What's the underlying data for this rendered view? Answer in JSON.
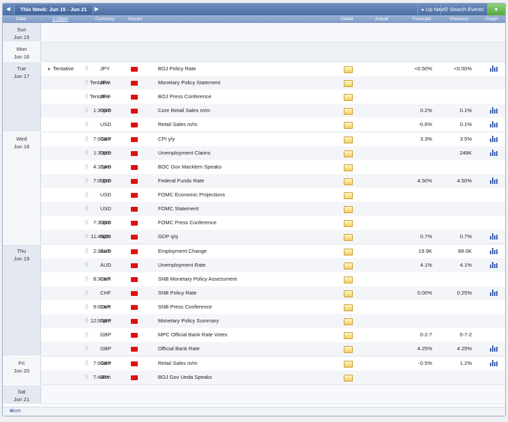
{
  "toolbar": {
    "prev_icon": "triangle-left",
    "week_label": "This Week: Jun 15 - Jun 21",
    "next_icon": "triangle-right",
    "up_next": "Up Next",
    "up_next_icon": "triangle-right",
    "search_events": "Search Events",
    "search_icon": "magnifier",
    "filter_icon": "funnel"
  },
  "headers": {
    "date": "Date",
    "time": "1:25pm",
    "currency": "Currency",
    "impact": "Impact",
    "detail": "Detail",
    "actual": "Actual",
    "forecast": "Forecast",
    "previous": "Previous",
    "graph": "Graph"
  },
  "days": [
    {
      "dow": "Sun",
      "date": "Jun 15"
    },
    {
      "dow": "Mon",
      "date": "Jun 16"
    },
    {
      "dow": "Tue",
      "date": "Jun 17"
    },
    {
      "dow": "Wed",
      "date": "Jun 18"
    },
    {
      "dow": "Thu",
      "date": "Jun 19"
    },
    {
      "dow": "Fri",
      "date": "Jun 20"
    },
    {
      "dow": "Sat",
      "date": "Jun 21"
    }
  ],
  "events": [
    {
      "time": "Tentative",
      "currency": "JPY",
      "title": "BOJ Policy Rate",
      "actual": "",
      "forecast": "<0.50%",
      "previous": "<0.50%",
      "graph": true
    },
    {
      "time": "Tentative",
      "currency": "JPY",
      "title": "Monetary Policy Statement",
      "actual": "",
      "forecast": "",
      "previous": "",
      "graph": false
    },
    {
      "time": "Tentative",
      "currency": "JPY",
      "title": "BOJ Press Conference",
      "actual": "",
      "forecast": "",
      "previous": "",
      "graph": false
    },
    {
      "time": "1:30pm",
      "currency": "USD",
      "title": "Core Retail Sales m/m",
      "actual": "",
      "forecast": "0.2%",
      "previous": "0.1%",
      "graph": true
    },
    {
      "time": "",
      "currency": "USD",
      "title": "Retail Sales m/m",
      "actual": "",
      "forecast": "-0.6%",
      "previous": "0.1%",
      "graph": true
    },
    {
      "time": "7:00am",
      "currency": "GBP",
      "title": "CPI y/y",
      "actual": "",
      "forecast": "3.3%",
      "previous": "3.5%",
      "graph": true
    },
    {
      "time": "1:30pm",
      "currency": "USD",
      "title": "Unemployment Claims",
      "actual": "",
      "forecast": "",
      "previous": "248K",
      "graph": true
    },
    {
      "time": "4:15pm",
      "currency": "CAD",
      "title": "BOC Gov Macklem Speaks",
      "actual": "",
      "forecast": "",
      "previous": "",
      "graph": false
    },
    {
      "time": "7:00pm",
      "currency": "USD",
      "title": "Federal Funds Rate",
      "actual": "",
      "forecast": "4.50%",
      "previous": "4.50%",
      "graph": true
    },
    {
      "time": "",
      "currency": "USD",
      "title": "FOMC Economic Projections",
      "actual": "",
      "forecast": "",
      "previous": "",
      "graph": false
    },
    {
      "time": "",
      "currency": "USD",
      "title": "FOMC Statement",
      "actual": "",
      "forecast": "",
      "previous": "",
      "graph": false
    },
    {
      "time": "7:30pm",
      "currency": "USD",
      "title": "FOMC Press Conference",
      "actual": "",
      "forecast": "",
      "previous": "",
      "graph": false
    },
    {
      "time": "11:45pm",
      "currency": "NZD",
      "title": "GDP q/q",
      "actual": "",
      "forecast": "0.7%",
      "previous": "0.7%",
      "graph": true
    },
    {
      "time": "2:30am",
      "currency": "AUD",
      "title": "Employment Change",
      "actual": "",
      "forecast": "19.9K",
      "previous": "89.0K",
      "graph": true
    },
    {
      "time": "",
      "currency": "AUD",
      "title": "Unemployment Rate",
      "actual": "",
      "forecast": "4.1%",
      "previous": "4.1%",
      "graph": true
    },
    {
      "time": "8:30am",
      "currency": "CHF",
      "title": "SNB Monetary Policy Assessment",
      "actual": "",
      "forecast": "",
      "previous": "",
      "graph": false
    },
    {
      "time": "",
      "currency": "CHF",
      "title": "SNB Policy Rate",
      "actual": "",
      "forecast": "0.00%",
      "previous": "0.25%",
      "graph": true
    },
    {
      "time": "9:00am",
      "currency": "CHF",
      "title": "SNB Press Conference",
      "actual": "",
      "forecast": "",
      "previous": "",
      "graph": false
    },
    {
      "time": "12:00pm",
      "currency": "GBP",
      "title": "Monetary Policy Summary",
      "actual": "",
      "forecast": "",
      "previous": "",
      "graph": false
    },
    {
      "time": "",
      "currency": "GBP",
      "title": "MPC Official Bank Rate Votes",
      "actual": "",
      "forecast": "0-2-7",
      "previous": "0-7-2",
      "graph": false
    },
    {
      "time": "",
      "currency": "GBP",
      "title": "Official Bank Rate",
      "actual": "",
      "forecast": "4.25%",
      "previous": "4.25%",
      "graph": true
    },
    {
      "time": "7:00am",
      "currency": "GBP",
      "title": "Retail Sales m/m",
      "actual": "",
      "forecast": "-0.5%",
      "previous": "1.2%",
      "graph": true
    },
    {
      "time": "7:40am",
      "currency": "JPY",
      "title": "BOJ Gov Ueda Speaks",
      "actual": "",
      "forecast": "",
      "previous": "",
      "graph": false
    }
  ],
  "footer": {
    "more_label": "More",
    "more_icon": "triangle-left"
  },
  "colors": {
    "impact_high": "#dd1111",
    "header": "#5a7bb0",
    "accent_green": "#55a83e"
  }
}
